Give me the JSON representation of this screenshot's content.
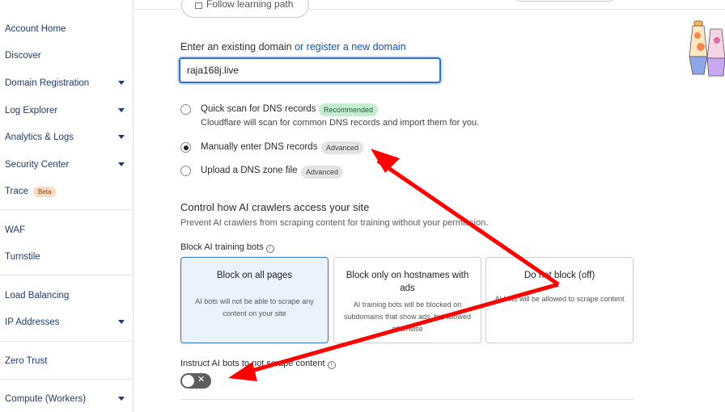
{
  "sidebar": {
    "items": [
      {
        "label": "Account Home"
      },
      {
        "label": "Discover"
      },
      {
        "label": "Domain Registration"
      },
      {
        "label": "Log Explorer"
      },
      {
        "label": "Analytics & Logs"
      },
      {
        "label": "Security Center"
      },
      {
        "label": "Trace",
        "badge": "Beta"
      },
      {
        "label": "WAF"
      },
      {
        "label": "Turnstile"
      },
      {
        "label": "Load Balancing"
      },
      {
        "label": "IP Addresses"
      },
      {
        "label": "Zero Trust"
      },
      {
        "label": "Compute (Workers)"
      }
    ]
  },
  "header": {
    "follow_label": "Follow learning path"
  },
  "domain": {
    "label_prefix": "Enter an existing domain",
    "label_link": "or register a new domain",
    "value": "raja168j.live"
  },
  "dns_options": [
    {
      "label": "Quick scan for DNS records",
      "badge": "Recommended",
      "description": "Cloudflare will scan for common DNS records and import them for you.",
      "checked": false
    },
    {
      "label": "Manually enter DNS records",
      "badge": "Advanced",
      "checked": true
    },
    {
      "label": "Upload a DNS zone file",
      "badge": "Advanced",
      "checked": false
    }
  ],
  "ai_crawlers": {
    "title": "Control how AI crawlers access your site",
    "description": "Prevent AI crawlers from scraping content for training without your permission.",
    "block_label": "Block AI training bots",
    "cards": [
      {
        "title": "Block on all pages",
        "description": "AI bots will not be able to scrape any content on your site",
        "selected": true
      },
      {
        "title": "Block only on hostnames with ads",
        "description": "AI training bots will be blocked on subdomains that show ads, but allowed otherwise",
        "selected": false
      },
      {
        "title": "Do not block (off)",
        "description": "AI bots will be allowed to scrape content",
        "selected": false
      }
    ],
    "instruct_label": "Instruct AI bots to not scrape content",
    "toggle_on": false
  },
  "colors": {
    "accent": "#2f6fcf",
    "link": "#0b54b8",
    "annotation_arrow": "#ff0000",
    "recommended_badge": "#c6ecd1"
  }
}
